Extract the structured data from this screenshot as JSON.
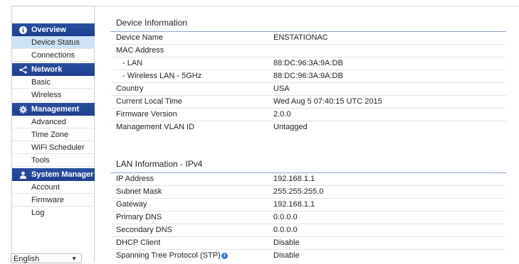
{
  "sidebar": {
    "sections": [
      {
        "title": "Overview",
        "icon": "info-icon",
        "items": [
          "Device Status",
          "Connections"
        ]
      },
      {
        "title": "Network",
        "icon": "share-icon",
        "items": [
          "Basic",
          "Wireless"
        ]
      },
      {
        "title": "Management",
        "icon": "gear-icon",
        "items": [
          "Advanced",
          "Time Zone",
          "WiFi Scheduler",
          "Tools"
        ]
      },
      {
        "title": "System Manager",
        "icon": "user-icon",
        "items": [
          "Account",
          "Firmware",
          "Log"
        ]
      }
    ],
    "active_item": "Device Status",
    "language": "English"
  },
  "device_info": {
    "title": "Device Information",
    "rows": [
      {
        "label": "Device Name",
        "value": "ENSTATIONAC"
      },
      {
        "label": "MAC Address",
        "value": ""
      },
      {
        "label": "- LAN",
        "value": "88:DC:96:3A:9A:DB"
      },
      {
        "label": "- Wireless LAN - 5GHz",
        "value": "88:DC:96:3A:9A:DB"
      },
      {
        "label": "Country",
        "value": "USA"
      },
      {
        "label": "Current Local Time",
        "value": "Wed Aug 5 07:40:15 UTC 2015"
      },
      {
        "label": "Firmware Version",
        "value": "2.0.0"
      },
      {
        "label": "Management VLAN ID",
        "value": "Untagged"
      }
    ]
  },
  "lan_info": {
    "title": "LAN Information - IPv4",
    "rows": [
      {
        "label": "IP Address",
        "value": "192.168.1.1"
      },
      {
        "label": "Subnet Mask",
        "value": "255.255.255.0"
      },
      {
        "label": "Gateway",
        "value": "192.168.1.1"
      },
      {
        "label": "Primary DNS",
        "value": "0.0.0.0"
      },
      {
        "label": "Secondary DNS",
        "value": "0.0.0.0"
      },
      {
        "label": "DHCP Client",
        "value": "Disable"
      },
      {
        "label": "Spanning Tree Protocol (STP)",
        "value": "Disable"
      }
    ]
  },
  "colors": {
    "header": "#1e3f8f",
    "active": "#cfe3f6",
    "info": "#2f7fd0"
  }
}
